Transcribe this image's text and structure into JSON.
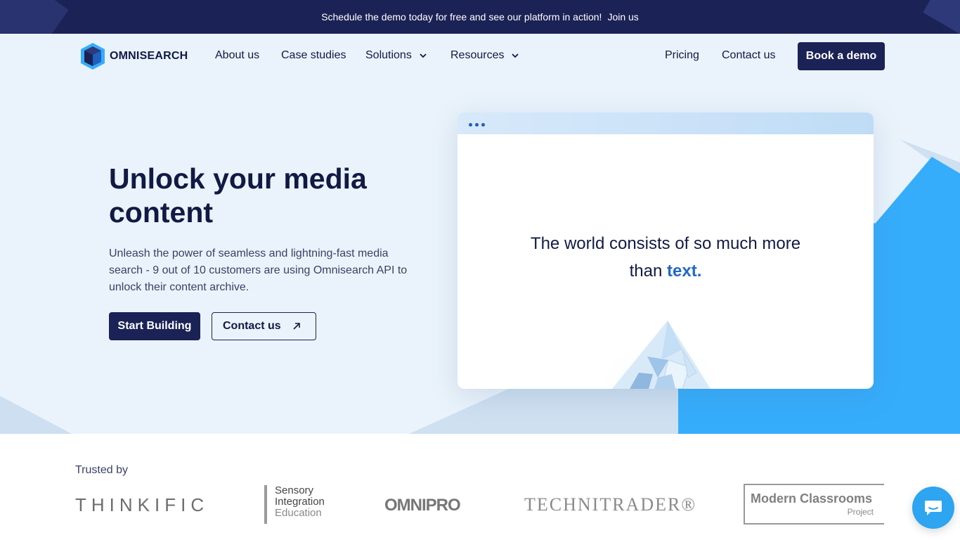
{
  "announcement": {
    "message": "Schedule the demo today for free and see our platform in action!",
    "link": "Join us"
  },
  "nav": {
    "brand": "OMNISEARCH",
    "items": [
      "About us",
      "Case studies",
      "Solutions",
      "Resources",
      "Pricing",
      "Contact us"
    ],
    "cta": "Book a demo"
  },
  "hero": {
    "title": "Unlock your media content",
    "description": "Unleash the power of seamless and lightning-fast media search - 9 out of 10 customers are using Omnisearch API to unlock their content archive.",
    "primary_button": "Start Building",
    "secondary_button": "Contact us"
  },
  "demo_window": {
    "quote_line1": "The world consists of so much more",
    "quote_line2_prefix": "than ",
    "quote_highlight": "text."
  },
  "trusted": {
    "label": "Trusted by",
    "logos": {
      "thinkific": "THINKIFIC",
      "sensory_1": "Sensory",
      "sensory_2": "Integration",
      "sensory_3": "Education",
      "omnipro": "OMNIPRO",
      "technitrader": "TECHNITRADER®",
      "modern_1": "Modern Classrooms",
      "modern_2": "Project"
    }
  },
  "colors": {
    "navy": "#1b2255",
    "hero_bg": "#eaf3fb",
    "accent_blue": "#36adfb",
    "highlight": "#2369c7"
  },
  "icons": [
    "omnisearch-logo-icon",
    "chevron-down-icon",
    "arrow-up-right-icon",
    "chat-icon"
  ]
}
